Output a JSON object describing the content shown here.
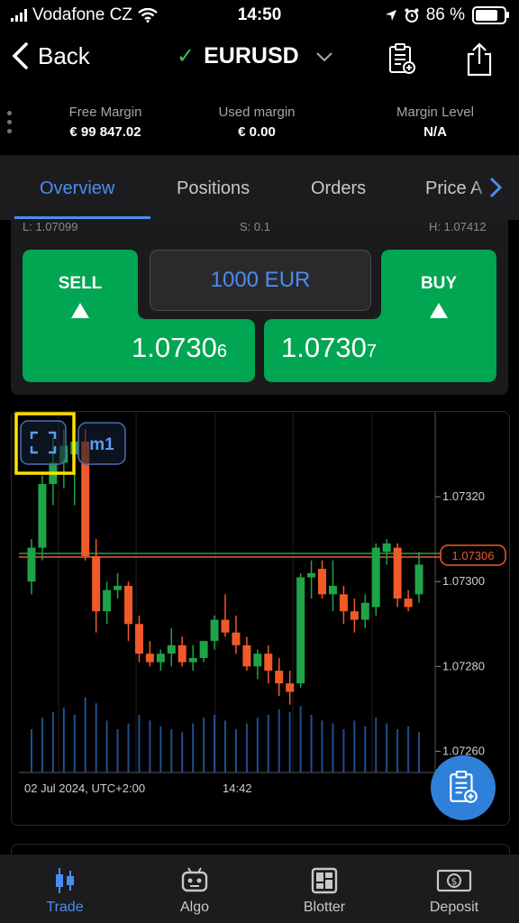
{
  "status_bar": {
    "carrier": "Vodafone CZ",
    "time": "14:50",
    "battery": "86 %"
  },
  "nav": {
    "back_label": "Back",
    "symbol": "EURUSD"
  },
  "margin": {
    "free_margin_label": "Free Margin",
    "free_margin_value": "€ 99 847.02",
    "used_margin_label": "Used margin",
    "used_margin_value": "€ 0.00",
    "margin_level_label": "Margin Level",
    "margin_level_value": "N/A"
  },
  "tabs": [
    "Overview",
    "Positions",
    "Orders",
    "Price A"
  ],
  "trade": {
    "low": "L: 1.07099",
    "spread": "S: 0.1",
    "high": "H: 1.07412",
    "sell_label": "SELL",
    "sell_price_main": "1.0730",
    "sell_price_pip": "6",
    "buy_label": "BUY",
    "buy_price_main": "1.0730",
    "buy_price_pip": "7",
    "amount": "1000  EUR",
    "sell_color": "#00a651",
    "buy_color": "#00a651"
  },
  "chart": {
    "timeframe": "m1",
    "date_label": "02 Jul 2024, UTC+2:00",
    "time_label": "14:42",
    "current_price": "1.07306",
    "up_color": "#1fa347",
    "down_color": "#f05a28"
  },
  "chart_data": {
    "type": "candlestick",
    "y_ticks": [
      "1.07320",
      "1.07300",
      "1.07280",
      "1.07260"
    ],
    "y_tick_values": [
      1.0732,
      1.073,
      1.0728,
      1.0726
    ],
    "ylim": [
      1.07255,
      1.0734
    ],
    "current_price": 1.07306,
    "candles": [
      {
        "o": 1.073,
        "h": 1.0731,
        "l": 1.07297,
        "c": 1.07308
      },
      {
        "o": 1.07308,
        "h": 1.07325,
        "l": 1.07305,
        "c": 1.07323
      },
      {
        "o": 1.07323,
        "h": 1.07334,
        "l": 1.07318,
        "c": 1.07328
      },
      {
        "o": 1.07328,
        "h": 1.07336,
        "l": 1.07322,
        "c": 1.07332
      },
      {
        "o": 1.0733,
        "h": 1.07338,
        "l": 1.07318,
        "c": 1.07333
      },
      {
        "o": 1.07333,
        "h": 1.07336,
        "l": 1.07305,
        "c": 1.07306
      },
      {
        "o": 1.07306,
        "h": 1.0731,
        "l": 1.07288,
        "c": 1.07293
      },
      {
        "o": 1.07293,
        "h": 1.073,
        "l": 1.0729,
        "c": 1.07298
      },
      {
        "o": 1.07298,
        "h": 1.07302,
        "l": 1.07296,
        "c": 1.07299
      },
      {
        "o": 1.07299,
        "h": 1.073,
        "l": 1.07286,
        "c": 1.0729
      },
      {
        "o": 1.0729,
        "h": 1.07292,
        "l": 1.07281,
        "c": 1.07283
      },
      {
        "o": 1.07283,
        "h": 1.07286,
        "l": 1.0728,
        "c": 1.07281
      },
      {
        "o": 1.07281,
        "h": 1.07284,
        "l": 1.07279,
        "c": 1.07283
      },
      {
        "o": 1.07283,
        "h": 1.07289,
        "l": 1.0728,
        "c": 1.07285
      },
      {
        "o": 1.07285,
        "h": 1.07287,
        "l": 1.0728,
        "c": 1.07281
      },
      {
        "o": 1.07281,
        "h": 1.07285,
        "l": 1.07279,
        "c": 1.07282
      },
      {
        "o": 1.07282,
        "h": 1.07286,
        "l": 1.07281,
        "c": 1.07286
      },
      {
        "o": 1.07286,
        "h": 1.07292,
        "l": 1.07284,
        "c": 1.07291
      },
      {
        "o": 1.07291,
        "h": 1.07297,
        "l": 1.07287,
        "c": 1.07288
      },
      {
        "o": 1.07288,
        "h": 1.07292,
        "l": 1.07283,
        "c": 1.07285
      },
      {
        "o": 1.07285,
        "h": 1.07287,
        "l": 1.07279,
        "c": 1.0728
      },
      {
        "o": 1.0728,
        "h": 1.07284,
        "l": 1.07277,
        "c": 1.07283
      },
      {
        "o": 1.07283,
        "h": 1.07285,
        "l": 1.07276,
        "c": 1.07279
      },
      {
        "o": 1.07279,
        "h": 1.07282,
        "l": 1.07273,
        "c": 1.07276
      },
      {
        "o": 1.07276,
        "h": 1.07279,
        "l": 1.07271,
        "c": 1.07274
      },
      {
        "o": 1.07276,
        "h": 1.07302,
        "l": 1.07275,
        "c": 1.07301
      },
      {
        "o": 1.07301,
        "h": 1.07305,
        "l": 1.07296,
        "c": 1.07302
      },
      {
        "o": 1.07303,
        "h": 1.07305,
        "l": 1.07296,
        "c": 1.07297
      },
      {
        "o": 1.07297,
        "h": 1.07305,
        "l": 1.07293,
        "c": 1.07299
      },
      {
        "o": 1.07297,
        "h": 1.07299,
        "l": 1.0729,
        "c": 1.07293
      },
      {
        "o": 1.07293,
        "h": 1.07296,
        "l": 1.07288,
        "c": 1.07291
      },
      {
        "o": 1.07291,
        "h": 1.07297,
        "l": 1.07289,
        "c": 1.07295
      },
      {
        "o": 1.07294,
        "h": 1.07309,
        "l": 1.07292,
        "c": 1.07308
      },
      {
        "o": 1.07307,
        "h": 1.0731,
        "l": 1.07304,
        "c": 1.07309
      },
      {
        "o": 1.07308,
        "h": 1.07309,
        "l": 1.07294,
        "c": 1.07296
      },
      {
        "o": 1.07296,
        "h": 1.07298,
        "l": 1.07293,
        "c": 1.07294
      },
      {
        "o": 1.07297,
        "h": 1.07307,
        "l": 1.07295,
        "c": 1.07304
      }
    ],
    "volumes": [
      30,
      38,
      42,
      45,
      40,
      52,
      48,
      36,
      30,
      34,
      40,
      36,
      32,
      30,
      28,
      34,
      38,
      40,
      36,
      30,
      34,
      38,
      40,
      44,
      42,
      46,
      40,
      36,
      34,
      30,
      36,
      32,
      38,
      34,
      30,
      32,
      28
    ]
  },
  "bottom_tabs": [
    "Trade",
    "Algo",
    "Blotter",
    "Deposit"
  ],
  "colors": {
    "accent": "#4a8df2",
    "highlight": "#ffe100"
  }
}
